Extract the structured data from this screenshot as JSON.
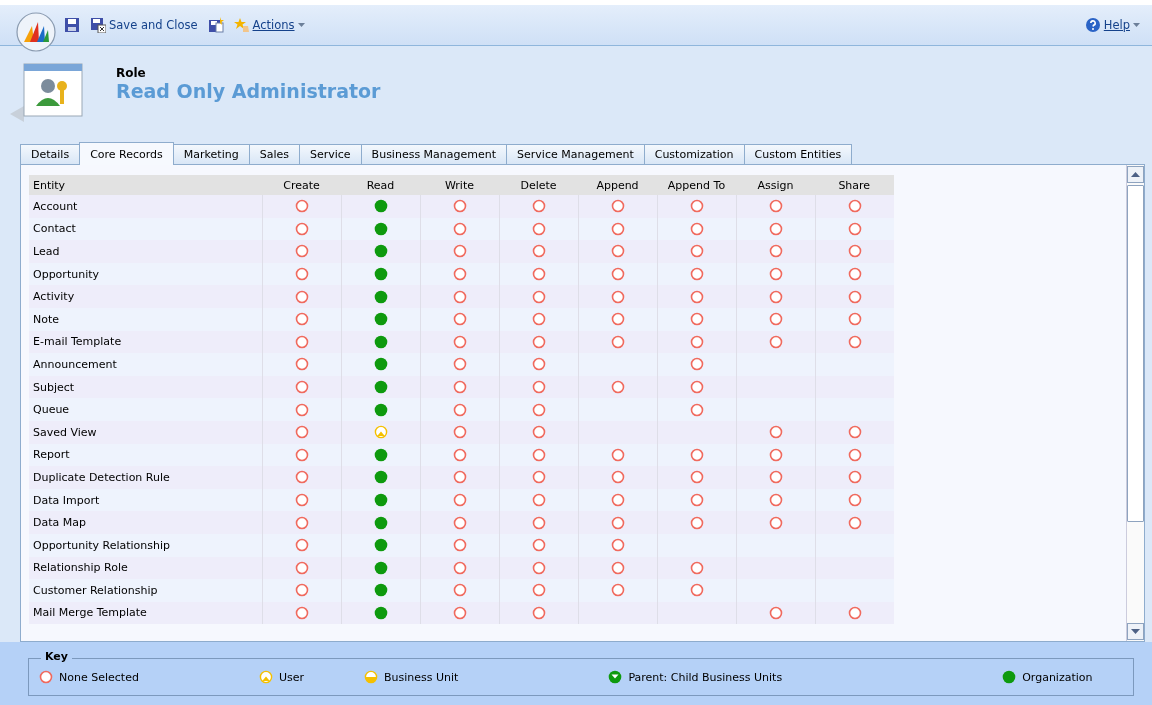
{
  "toolbar": {
    "save_and_close": "Save and Close",
    "actions": "Actions",
    "help": "Help"
  },
  "header": {
    "entity_type": "Role",
    "title": "Read Only Administrator"
  },
  "tabs": [
    {
      "label": "Details",
      "selected": false
    },
    {
      "label": "Core Records",
      "selected": true
    },
    {
      "label": "Marketing",
      "selected": false
    },
    {
      "label": "Sales",
      "selected": false
    },
    {
      "label": "Service",
      "selected": false
    },
    {
      "label": "Business Management",
      "selected": false
    },
    {
      "label": "Service Management",
      "selected": false
    },
    {
      "label": "Customization",
      "selected": false
    },
    {
      "label": "Custom Entities",
      "selected": false
    }
  ],
  "grid": {
    "columns": [
      "Entity",
      "Create",
      "Read",
      "Write",
      "Delete",
      "Append",
      "Append To",
      "Assign",
      "Share"
    ],
    "rows": [
      {
        "entity": "Account",
        "create": {
          "kind": "none"
        },
        "read": {
          "kind": "org"
        },
        "write": {
          "kind": "none"
        },
        "delete": {
          "kind": "none"
        },
        "append": {
          "kind": "none"
        },
        "append_to": {
          "kind": "none"
        },
        "assign": {
          "kind": "none"
        },
        "share": {
          "kind": "none"
        }
      },
      {
        "entity": "Contact",
        "create": {
          "kind": "none"
        },
        "read": {
          "kind": "org"
        },
        "write": {
          "kind": "none"
        },
        "delete": {
          "kind": "none"
        },
        "append": {
          "kind": "none"
        },
        "append_to": {
          "kind": "none"
        },
        "assign": {
          "kind": "none"
        },
        "share": {
          "kind": "none"
        }
      },
      {
        "entity": "Lead",
        "create": {
          "kind": "none"
        },
        "read": {
          "kind": "org"
        },
        "write": {
          "kind": "none"
        },
        "delete": {
          "kind": "none"
        },
        "append": {
          "kind": "none"
        },
        "append_to": {
          "kind": "none"
        },
        "assign": {
          "kind": "none"
        },
        "share": {
          "kind": "none"
        }
      },
      {
        "entity": "Opportunity",
        "create": {
          "kind": "none"
        },
        "read": {
          "kind": "org"
        },
        "write": {
          "kind": "none"
        },
        "delete": {
          "kind": "none"
        },
        "append": {
          "kind": "none"
        },
        "append_to": {
          "kind": "none"
        },
        "assign": {
          "kind": "none"
        },
        "share": {
          "kind": "none"
        }
      },
      {
        "entity": "Activity",
        "create": {
          "kind": "none"
        },
        "read": {
          "kind": "org"
        },
        "write": {
          "kind": "none"
        },
        "delete": {
          "kind": "none"
        },
        "append": {
          "kind": "none"
        },
        "append_to": {
          "kind": "none"
        },
        "assign": {
          "kind": "none"
        },
        "share": {
          "kind": "none"
        }
      },
      {
        "entity": "Note",
        "create": {
          "kind": "none"
        },
        "read": {
          "kind": "org"
        },
        "write": {
          "kind": "none"
        },
        "delete": {
          "kind": "none"
        },
        "append": {
          "kind": "none"
        },
        "append_to": {
          "kind": "none"
        },
        "assign": {
          "kind": "none"
        },
        "share": {
          "kind": "none"
        }
      },
      {
        "entity": "E-mail Template",
        "create": {
          "kind": "none"
        },
        "read": {
          "kind": "org"
        },
        "write": {
          "kind": "none"
        },
        "delete": {
          "kind": "none"
        },
        "append": {
          "kind": "none"
        },
        "append_to": {
          "kind": "none"
        },
        "assign": {
          "kind": "none"
        },
        "share": {
          "kind": "none"
        }
      },
      {
        "entity": "Announcement",
        "create": {
          "kind": "none"
        },
        "read": {
          "kind": "org"
        },
        "write": {
          "kind": "none"
        },
        "delete": {
          "kind": "none"
        },
        "append_to": {
          "kind": "none"
        }
      },
      {
        "entity": "Subject",
        "create": {
          "kind": "none"
        },
        "read": {
          "kind": "org"
        },
        "write": {
          "kind": "none"
        },
        "delete": {
          "kind": "none"
        },
        "append": {
          "kind": "none"
        },
        "append_to": {
          "kind": "none"
        }
      },
      {
        "entity": "Queue",
        "create": {
          "kind": "none"
        },
        "read": {
          "kind": "org"
        },
        "write": {
          "kind": "none"
        },
        "delete": {
          "kind": "none"
        },
        "append_to": {
          "kind": "none"
        }
      },
      {
        "entity": "Saved View",
        "create": {
          "kind": "none"
        },
        "read": {
          "kind": "user"
        },
        "write": {
          "kind": "none"
        },
        "delete": {
          "kind": "none"
        },
        "assign": {
          "kind": "none"
        },
        "share": {
          "kind": "none"
        }
      },
      {
        "entity": "Report",
        "create": {
          "kind": "none"
        },
        "read": {
          "kind": "org"
        },
        "write": {
          "kind": "none"
        },
        "delete": {
          "kind": "none"
        },
        "append": {
          "kind": "none"
        },
        "append_to": {
          "kind": "none"
        },
        "assign": {
          "kind": "none"
        },
        "share": {
          "kind": "none"
        }
      },
      {
        "entity": "Duplicate Detection Rule",
        "create": {
          "kind": "none"
        },
        "read": {
          "kind": "org"
        },
        "write": {
          "kind": "none"
        },
        "delete": {
          "kind": "none"
        },
        "append": {
          "kind": "none"
        },
        "append_to": {
          "kind": "none"
        },
        "assign": {
          "kind": "none"
        },
        "share": {
          "kind": "none"
        }
      },
      {
        "entity": "Data Import",
        "create": {
          "kind": "none"
        },
        "read": {
          "kind": "org"
        },
        "write": {
          "kind": "none"
        },
        "delete": {
          "kind": "none"
        },
        "append": {
          "kind": "none"
        },
        "append_to": {
          "kind": "none"
        },
        "assign": {
          "kind": "none"
        },
        "share": {
          "kind": "none"
        }
      },
      {
        "entity": "Data Map",
        "create": {
          "kind": "none"
        },
        "read": {
          "kind": "org"
        },
        "write": {
          "kind": "none"
        },
        "delete": {
          "kind": "none"
        },
        "append": {
          "kind": "none"
        },
        "append_to": {
          "kind": "none"
        },
        "assign": {
          "kind": "none"
        },
        "share": {
          "kind": "none"
        }
      },
      {
        "entity": "Opportunity Relationship",
        "create": {
          "kind": "none"
        },
        "read": {
          "kind": "org"
        },
        "write": {
          "kind": "none"
        },
        "delete": {
          "kind": "none"
        },
        "append": {
          "kind": "none"
        }
      },
      {
        "entity": "Relationship Role",
        "create": {
          "kind": "none"
        },
        "read": {
          "kind": "org"
        },
        "write": {
          "kind": "none"
        },
        "delete": {
          "kind": "none"
        },
        "append": {
          "kind": "none"
        },
        "append_to": {
          "kind": "none"
        }
      },
      {
        "entity": "Customer Relationship",
        "create": {
          "kind": "none"
        },
        "read": {
          "kind": "org"
        },
        "write": {
          "kind": "none"
        },
        "delete": {
          "kind": "none"
        },
        "append": {
          "kind": "none"
        },
        "append_to": {
          "kind": "none"
        }
      },
      {
        "entity": "Mail Merge Template",
        "create": {
          "kind": "none"
        },
        "read": {
          "kind": "org"
        },
        "write": {
          "kind": "none"
        },
        "delete": {
          "kind": "none"
        },
        "assign": {
          "kind": "none"
        },
        "share": {
          "kind": "none"
        }
      }
    ]
  },
  "key": {
    "title": "Key",
    "items": [
      {
        "kind": "none",
        "label": "None Selected"
      },
      {
        "kind": "user",
        "label": "User"
      },
      {
        "kind": "bu",
        "label": "Business Unit"
      },
      {
        "kind": "parent",
        "label": "Parent: Child Business Units"
      },
      {
        "kind": "org",
        "label": "Organization"
      }
    ]
  }
}
